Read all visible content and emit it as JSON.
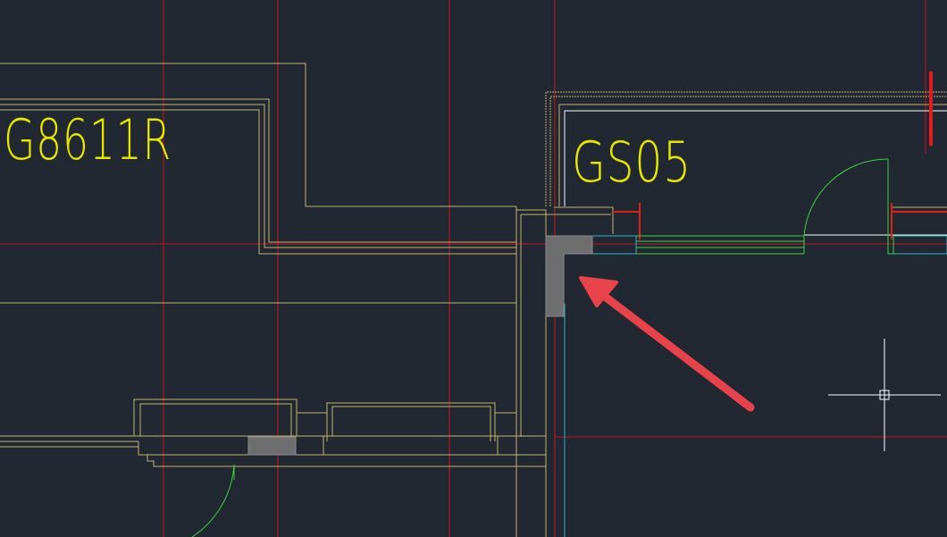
{
  "canvas": {
    "background": "#212832"
  },
  "colors": {
    "grid": "#c0141c",
    "wall": "#c7b06c",
    "door": "#3bd13b",
    "glazing": "#22b8c8",
    "frame": "#ffffff",
    "column": "#6e6e6e",
    "label": "#e6e600",
    "arrow": "#e8434b",
    "cursor": "#ffffff"
  },
  "rooms": [
    {
      "id": "room-g8611r",
      "label": "G8611R"
    },
    {
      "id": "room-gs05",
      "label": "GS05"
    }
  ],
  "annotation": {
    "type": "arrow",
    "points_to": "corner-column"
  },
  "cursor": {
    "type": "crosshair"
  }
}
